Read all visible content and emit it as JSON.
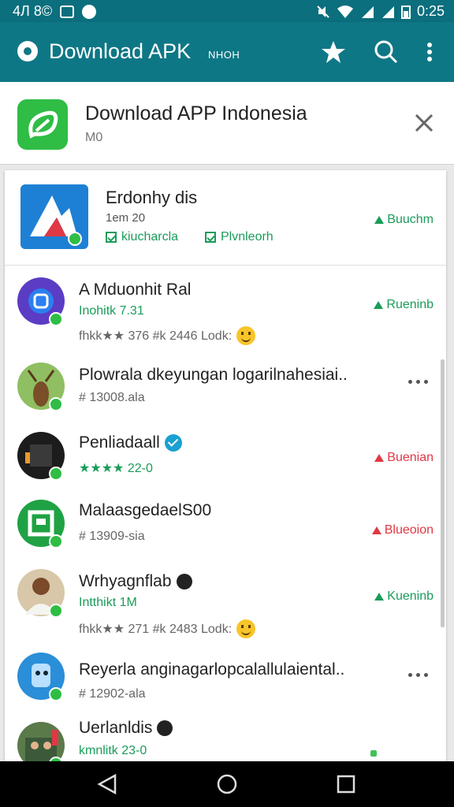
{
  "statusbar": {
    "left_text": "4Л 8©",
    "time": "0:25"
  },
  "toolbar": {
    "title": "Download APK",
    "subtitle": "NHOH"
  },
  "header": {
    "app_name": "Download APP Indonesia",
    "sub": "M0"
  },
  "featured": {
    "name": "Erdonhy dis",
    "meta": "1em 20",
    "tag1": "kiucharcla",
    "tag2": "Plvnleorh",
    "action": "Buuchm"
  },
  "items": [
    {
      "title": "A Mduonhit Ral",
      "line2": "Inohitk 7.31",
      "line3": "fhkk★★ 376 #k 2446 Lodk:",
      "action": "Rueninb",
      "action_color": "green"
    },
    {
      "title": "Plowrala dkeyungan logarilnahesiai..",
      "line2": "# 13008.ala"
    },
    {
      "title": "Penliadaall",
      "line2": "★★★★ 22-0",
      "action": "Buenian",
      "action_color": "red"
    },
    {
      "title": "MalaasgedaelS00",
      "line2": "# 13909-sia",
      "action": "Blueoion",
      "action_color": "red"
    },
    {
      "title": "Wrhyagnflab",
      "line2": "Intthikt 1M",
      "line3": "fhkk★★ 271 #k 2483 Lodk:",
      "action": "Kueninb",
      "action_color": "green"
    },
    {
      "title": "Reyerla anginagarlopcalallulaiental..",
      "line2": "# 12902-ala"
    },
    {
      "title": "Uerlanldis",
      "line2": "kmnlitk 23-0"
    }
  ]
}
